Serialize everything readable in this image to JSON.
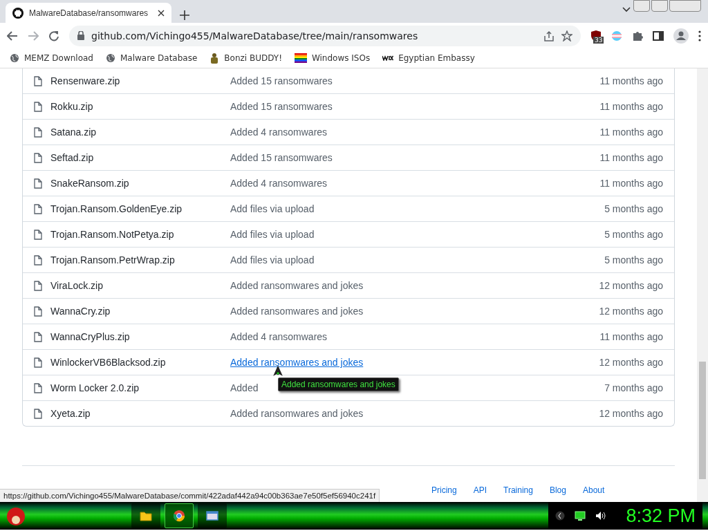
{
  "tab": {
    "title": "MalwareDatabase/ransomwares",
    "selected": true
  },
  "address": {
    "value": "github.com/Vichingo455/MalwareDatabase/tree/main/ransomwares"
  },
  "extension_badge": "33",
  "bookmarks": [
    {
      "label": "MEMZ Download",
      "kind": "globe"
    },
    {
      "label": "Malware Database",
      "kind": "globe"
    },
    {
      "label": "Bonzi BUDDY!",
      "kind": "figure"
    },
    {
      "label": "Windows ISOs",
      "kind": "rainbow"
    },
    {
      "label": "Egyptian Embassy",
      "kind": "wix"
    }
  ],
  "files": [
    {
      "name": "Rensenware.zip",
      "message": "Added 15 ransomwares",
      "time": "11 months ago",
      "hovered": false
    },
    {
      "name": "Rokku.zip",
      "message": "Added 15 ransomwares",
      "time": "11 months ago",
      "hovered": false
    },
    {
      "name": "Satana.zip",
      "message": "Added 4 ransomwares",
      "time": "11 months ago",
      "hovered": false
    },
    {
      "name": "Seftad.zip",
      "message": "Added 15 ransomwares",
      "time": "11 months ago",
      "hovered": false
    },
    {
      "name": "SnakeRansom.zip",
      "message": "Added 4 ransomwares",
      "time": "11 months ago",
      "hovered": false
    },
    {
      "name": "Trojan.Ransom.GoldenEye.zip",
      "message": "Add files via upload",
      "time": "5 months ago",
      "hovered": false
    },
    {
      "name": "Trojan.Ransom.NotPetya.zip",
      "message": "Add files via upload",
      "time": "5 months ago",
      "hovered": false
    },
    {
      "name": "Trojan.Ransom.PetrWrap.zip",
      "message": "Add files via upload",
      "time": "5 months ago",
      "hovered": false
    },
    {
      "name": "ViraLock.zip",
      "message": "Added ransomwares and jokes",
      "time": "12 months ago",
      "hovered": false
    },
    {
      "name": "WannaCry.zip",
      "message": "Added ransomwares and jokes",
      "time": "12 months ago",
      "hovered": false
    },
    {
      "name": "WannaCryPlus.zip",
      "message": "Added 4 ransomwares",
      "time": "11 months ago",
      "hovered": false
    },
    {
      "name": "WinlockerVB6Blacksod.zip",
      "message": "Added ransomwares and jokes",
      "time": "12 months ago",
      "hovered": true
    },
    {
      "name": "Worm Locker 2.0.zip",
      "message": "Added",
      "time": "7 months ago",
      "hovered": false
    },
    {
      "name": "Xyeta.zip",
      "message": "Added ransomwares and jokes",
      "time": "12 months ago",
      "hovered": false
    }
  ],
  "tooltip": "Added ransomwares and jokes",
  "footer_links": [
    "Pricing",
    "API",
    "Training",
    "Blog",
    "About"
  ],
  "status_url": "https://github.com/Vichingo455/MalwareDatabase/commit/422adaf442a94c00b363ae7e50f5ef56940c241f",
  "taskbar": {
    "apps": [
      {
        "kind": "folder",
        "selected": false
      },
      {
        "kind": "browser",
        "selected": true
      },
      {
        "kind": "window",
        "selected": false
      }
    ],
    "clock": "8:32 PM"
  }
}
